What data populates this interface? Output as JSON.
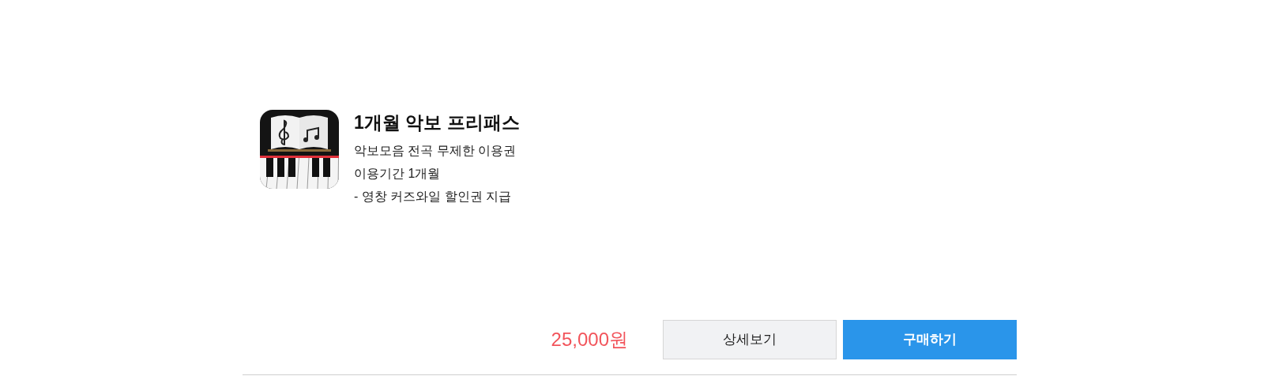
{
  "product": {
    "title": "1개월 악보 프리패스",
    "lines": [
      "악보모음 전곡 무제한 이용권",
      "이용기간 1개월",
      "- 영창 커즈와일 할인권 지급"
    ]
  },
  "price": "25,000원",
  "buttons": [
    {
      "kind": "secondary",
      "label": "상세보기"
    },
    {
      "kind": "primary",
      "label": "구매하기"
    }
  ]
}
